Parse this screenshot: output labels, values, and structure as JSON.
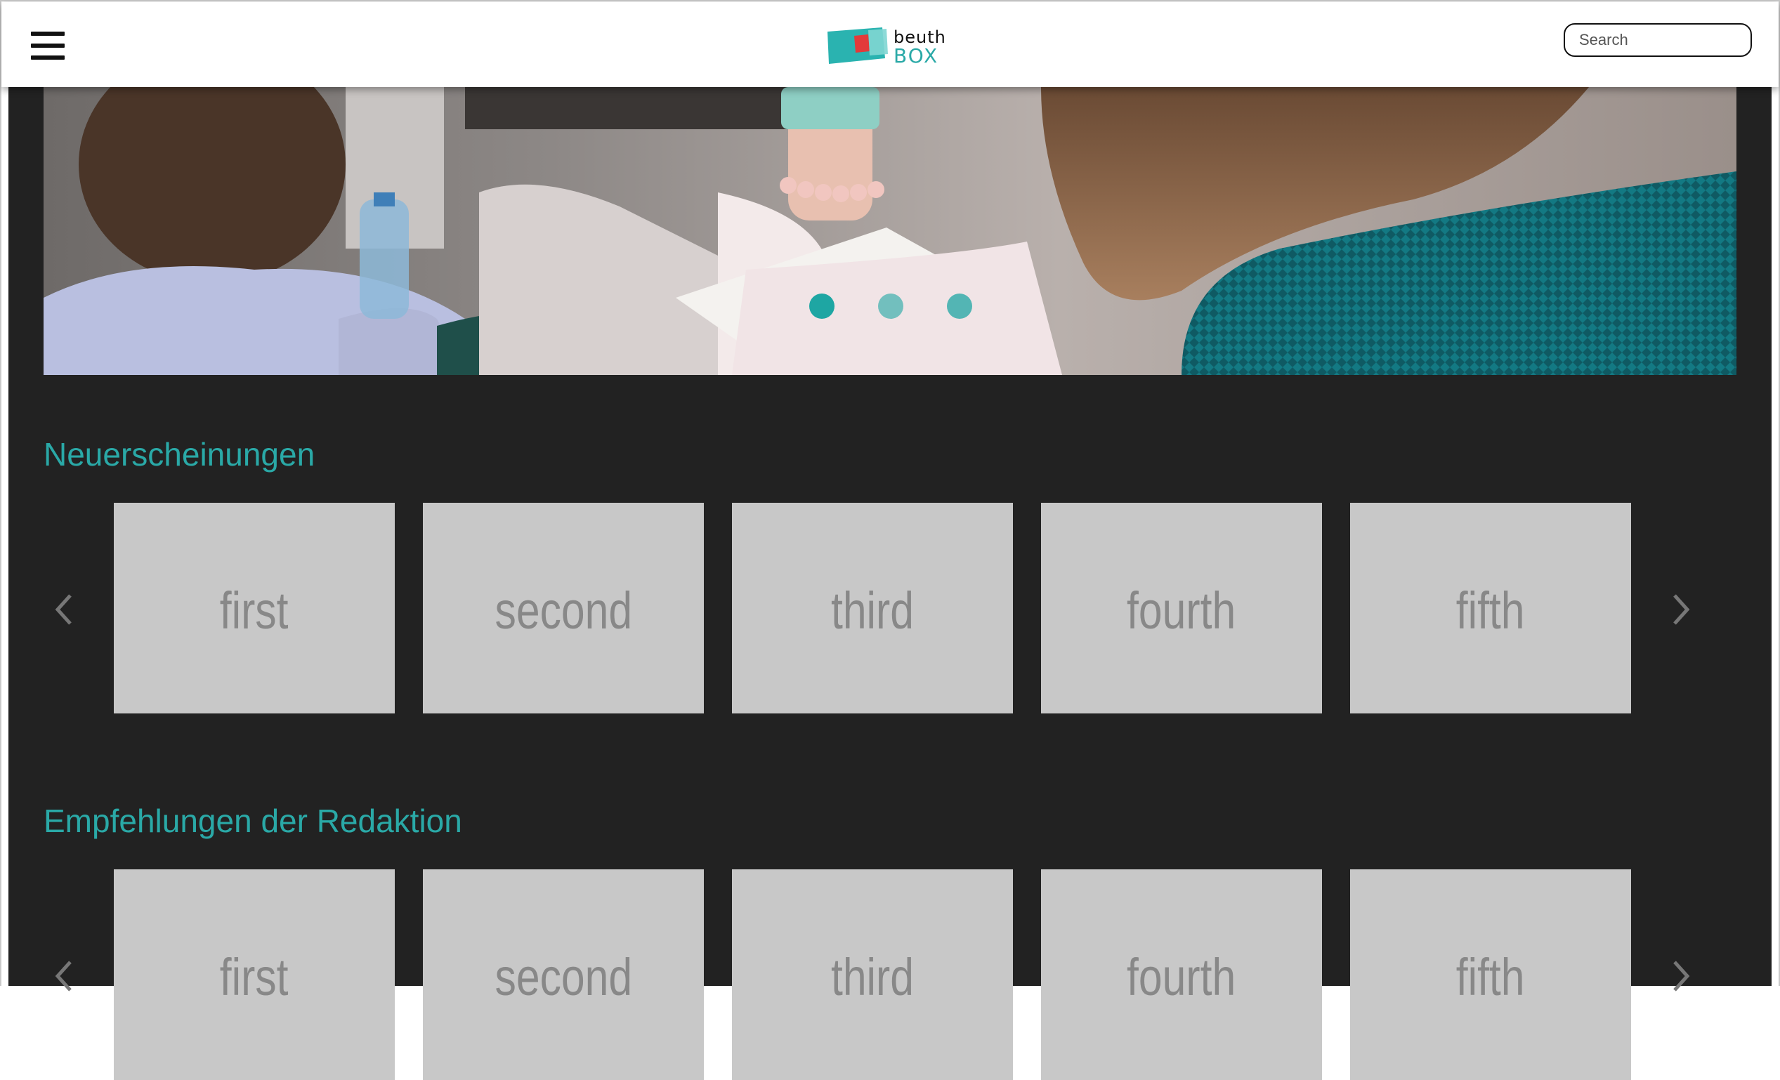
{
  "header": {
    "menu_icon": "hamburger-menu-icon",
    "logo": {
      "line1": "beuth",
      "line2": "BOX"
    },
    "search": {
      "placeholder": "Search",
      "value": ""
    }
  },
  "hero": {
    "slide_count": 3,
    "active_slide": 1,
    "accent_color": "#1ea6a3"
  },
  "sections": [
    {
      "title": "Neuerscheinungen",
      "cards": [
        "first",
        "second",
        "third",
        "fourth",
        "fifth"
      ]
    },
    {
      "title": "Empfehlungen der Redaktion",
      "cards": [
        "first",
        "second",
        "third",
        "fourth",
        "fifth"
      ]
    }
  ],
  "colors": {
    "accent": "#2aa9a7",
    "page_background": "#222222",
    "card_background": "#c8c8c8",
    "card_text": "#888888"
  }
}
